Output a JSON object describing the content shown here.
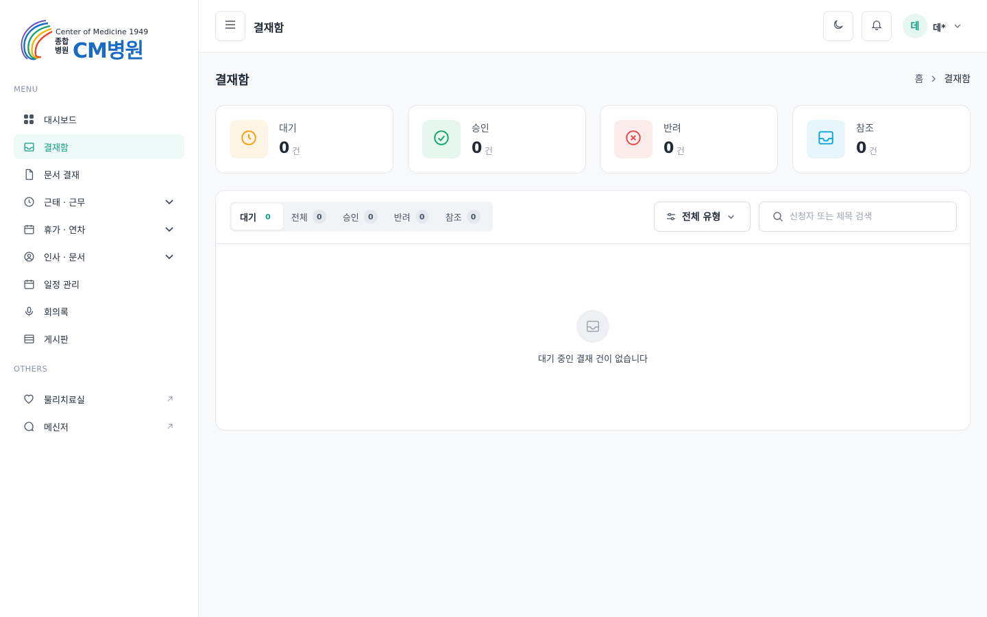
{
  "logo": {
    "tagline": "Center of Medicine 1949",
    "small_text": "종합 병원",
    "name": "CM병원"
  },
  "sidebar": {
    "menu_label": "MENU",
    "others_label": "OTHERS",
    "items": [
      {
        "label": "대시보드",
        "icon": "grid-icon",
        "active": false,
        "expandable": false
      },
      {
        "label": "결재함",
        "icon": "inbox-icon",
        "active": true,
        "expandable": false
      },
      {
        "label": "문서 결재",
        "icon": "file-icon",
        "active": false,
        "expandable": false
      },
      {
        "label": "근태 · 근무",
        "icon": "clock-icon",
        "active": false,
        "expandable": true
      },
      {
        "label": "휴가 · 연차",
        "icon": "calendar-icon",
        "active": false,
        "expandable": true
      },
      {
        "label": "인사 · 문서",
        "icon": "user-circle-icon",
        "active": false,
        "expandable": true
      },
      {
        "label": "일정 관리",
        "icon": "calendar-icon",
        "active": false,
        "expandable": false
      },
      {
        "label": "회의록",
        "icon": "microphone-icon",
        "active": false,
        "expandable": false
      },
      {
        "label": "게시판",
        "icon": "board-icon",
        "active": false,
        "expandable": false
      }
    ],
    "others": [
      {
        "label": "물리치료실",
        "icon": "heart-icon",
        "external": true
      },
      {
        "label": "메신저",
        "icon": "chat-icon",
        "external": true
      }
    ]
  },
  "header": {
    "title": "결재함",
    "user_initial": "데",
    "user_name": "데*"
  },
  "page": {
    "title": "결재함",
    "breadcrumb": [
      "홈",
      "결재함"
    ]
  },
  "stats": [
    {
      "label": "대기",
      "value": "0",
      "unit": "건",
      "icon": "clock-icon",
      "color": "#f59e0b",
      "bg": "#fef5e7"
    },
    {
      "label": "승인",
      "value": "0",
      "unit": "건",
      "icon": "check-circle-icon",
      "color": "#10a572",
      "bg": "#e6f7ef"
    },
    {
      "label": "반려",
      "value": "0",
      "unit": "건",
      "icon": "x-circle-icon",
      "color": "#e5484d",
      "bg": "#fdecec"
    },
    {
      "label": "참조",
      "value": "0",
      "unit": "건",
      "icon": "inbox-icon",
      "color": "#0ea5d9",
      "bg": "#e6f6fc"
    }
  ],
  "tabs": [
    {
      "label": "대기",
      "count": "0",
      "active": true
    },
    {
      "label": "전체",
      "count": "0",
      "active": false
    },
    {
      "label": "승인",
      "count": "0",
      "active": false
    },
    {
      "label": "반려",
      "count": "0",
      "active": false
    },
    {
      "label": "참조",
      "count": "0",
      "active": false
    }
  ],
  "filter": {
    "label": "전체 유형"
  },
  "search": {
    "placeholder": "신청자 또는 제목 검색",
    "value": ""
  },
  "empty": {
    "message": "대기 중인 결재 건이 없습니다"
  }
}
